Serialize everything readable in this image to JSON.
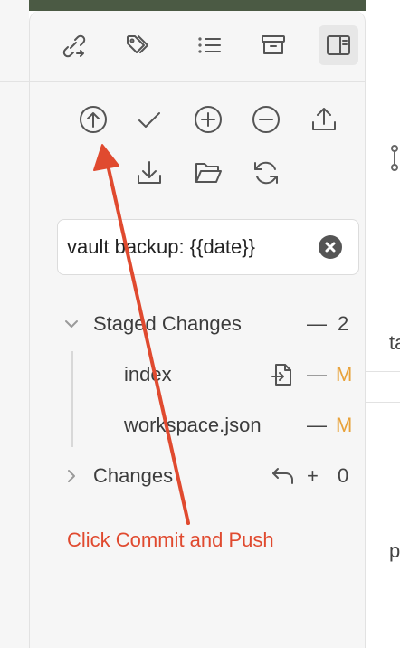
{
  "header": {
    "icons": [
      "link-arrow-icon",
      "tags-icon",
      "list-icon",
      "archive-icon",
      "sidebar-toggle-icon"
    ]
  },
  "toolbar": {
    "row1": [
      "commit-and-push-icon",
      "commit-icon",
      "stage-all-icon",
      "unstage-all-icon",
      "push-icon"
    ],
    "row2": [
      "pull-icon",
      "open-folder-icon",
      "refresh-icon"
    ]
  },
  "commit_message": {
    "value": "vault backup: {{date}}"
  },
  "staged": {
    "label": "Staged Changes",
    "dash": "—",
    "count": "2",
    "files": [
      {
        "name": "index",
        "status": "M",
        "dash": "—"
      },
      {
        "name": "workspace.json",
        "status": "M",
        "dash": "—"
      }
    ]
  },
  "changes": {
    "label": "Changes",
    "plus": "+",
    "count": "0"
  },
  "annotation": {
    "text": "Click Commit and Push",
    "color": "#e04a2f"
  },
  "right_fragments": [
    "ta",
    "p,"
  ],
  "colors": {
    "modified": "#e8a23a",
    "accent_arrow": "#e04a2f"
  }
}
